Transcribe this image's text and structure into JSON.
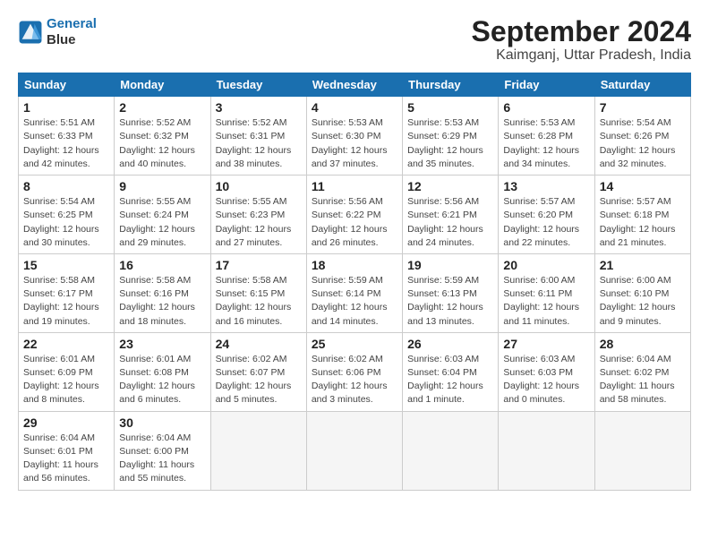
{
  "logo": {
    "line1": "General",
    "line2": "Blue"
  },
  "title": "September 2024",
  "location": "Kaimganj, Uttar Pradesh, India",
  "days_of_week": [
    "Sunday",
    "Monday",
    "Tuesday",
    "Wednesday",
    "Thursday",
    "Friday",
    "Saturday"
  ],
  "weeks": [
    [
      {
        "day": 1,
        "info": "Sunrise: 5:51 AM\nSunset: 6:33 PM\nDaylight: 12 hours\nand 42 minutes."
      },
      {
        "day": 2,
        "info": "Sunrise: 5:52 AM\nSunset: 6:32 PM\nDaylight: 12 hours\nand 40 minutes."
      },
      {
        "day": 3,
        "info": "Sunrise: 5:52 AM\nSunset: 6:31 PM\nDaylight: 12 hours\nand 38 minutes."
      },
      {
        "day": 4,
        "info": "Sunrise: 5:53 AM\nSunset: 6:30 PM\nDaylight: 12 hours\nand 37 minutes."
      },
      {
        "day": 5,
        "info": "Sunrise: 5:53 AM\nSunset: 6:29 PM\nDaylight: 12 hours\nand 35 minutes."
      },
      {
        "day": 6,
        "info": "Sunrise: 5:53 AM\nSunset: 6:28 PM\nDaylight: 12 hours\nand 34 minutes."
      },
      {
        "day": 7,
        "info": "Sunrise: 5:54 AM\nSunset: 6:26 PM\nDaylight: 12 hours\nand 32 minutes."
      }
    ],
    [
      {
        "day": 8,
        "info": "Sunrise: 5:54 AM\nSunset: 6:25 PM\nDaylight: 12 hours\nand 30 minutes."
      },
      {
        "day": 9,
        "info": "Sunrise: 5:55 AM\nSunset: 6:24 PM\nDaylight: 12 hours\nand 29 minutes."
      },
      {
        "day": 10,
        "info": "Sunrise: 5:55 AM\nSunset: 6:23 PM\nDaylight: 12 hours\nand 27 minutes."
      },
      {
        "day": 11,
        "info": "Sunrise: 5:56 AM\nSunset: 6:22 PM\nDaylight: 12 hours\nand 26 minutes."
      },
      {
        "day": 12,
        "info": "Sunrise: 5:56 AM\nSunset: 6:21 PM\nDaylight: 12 hours\nand 24 minutes."
      },
      {
        "day": 13,
        "info": "Sunrise: 5:57 AM\nSunset: 6:20 PM\nDaylight: 12 hours\nand 22 minutes."
      },
      {
        "day": 14,
        "info": "Sunrise: 5:57 AM\nSunset: 6:18 PM\nDaylight: 12 hours\nand 21 minutes."
      }
    ],
    [
      {
        "day": 15,
        "info": "Sunrise: 5:58 AM\nSunset: 6:17 PM\nDaylight: 12 hours\nand 19 minutes."
      },
      {
        "day": 16,
        "info": "Sunrise: 5:58 AM\nSunset: 6:16 PM\nDaylight: 12 hours\nand 18 minutes."
      },
      {
        "day": 17,
        "info": "Sunrise: 5:58 AM\nSunset: 6:15 PM\nDaylight: 12 hours\nand 16 minutes."
      },
      {
        "day": 18,
        "info": "Sunrise: 5:59 AM\nSunset: 6:14 PM\nDaylight: 12 hours\nand 14 minutes."
      },
      {
        "day": 19,
        "info": "Sunrise: 5:59 AM\nSunset: 6:13 PM\nDaylight: 12 hours\nand 13 minutes."
      },
      {
        "day": 20,
        "info": "Sunrise: 6:00 AM\nSunset: 6:11 PM\nDaylight: 12 hours\nand 11 minutes."
      },
      {
        "day": 21,
        "info": "Sunrise: 6:00 AM\nSunset: 6:10 PM\nDaylight: 12 hours\nand 9 minutes."
      }
    ],
    [
      {
        "day": 22,
        "info": "Sunrise: 6:01 AM\nSunset: 6:09 PM\nDaylight: 12 hours\nand 8 minutes."
      },
      {
        "day": 23,
        "info": "Sunrise: 6:01 AM\nSunset: 6:08 PM\nDaylight: 12 hours\nand 6 minutes."
      },
      {
        "day": 24,
        "info": "Sunrise: 6:02 AM\nSunset: 6:07 PM\nDaylight: 12 hours\nand 5 minutes."
      },
      {
        "day": 25,
        "info": "Sunrise: 6:02 AM\nSunset: 6:06 PM\nDaylight: 12 hours\nand 3 minutes."
      },
      {
        "day": 26,
        "info": "Sunrise: 6:03 AM\nSunset: 6:04 PM\nDaylight: 12 hours\nand 1 minute."
      },
      {
        "day": 27,
        "info": "Sunrise: 6:03 AM\nSunset: 6:03 PM\nDaylight: 12 hours\nand 0 minutes."
      },
      {
        "day": 28,
        "info": "Sunrise: 6:04 AM\nSunset: 6:02 PM\nDaylight: 11 hours\nand 58 minutes."
      }
    ],
    [
      {
        "day": 29,
        "info": "Sunrise: 6:04 AM\nSunset: 6:01 PM\nDaylight: 11 hours\nand 56 minutes."
      },
      {
        "day": 30,
        "info": "Sunrise: 6:04 AM\nSunset: 6:00 PM\nDaylight: 11 hours\nand 55 minutes."
      },
      null,
      null,
      null,
      null,
      null
    ]
  ]
}
